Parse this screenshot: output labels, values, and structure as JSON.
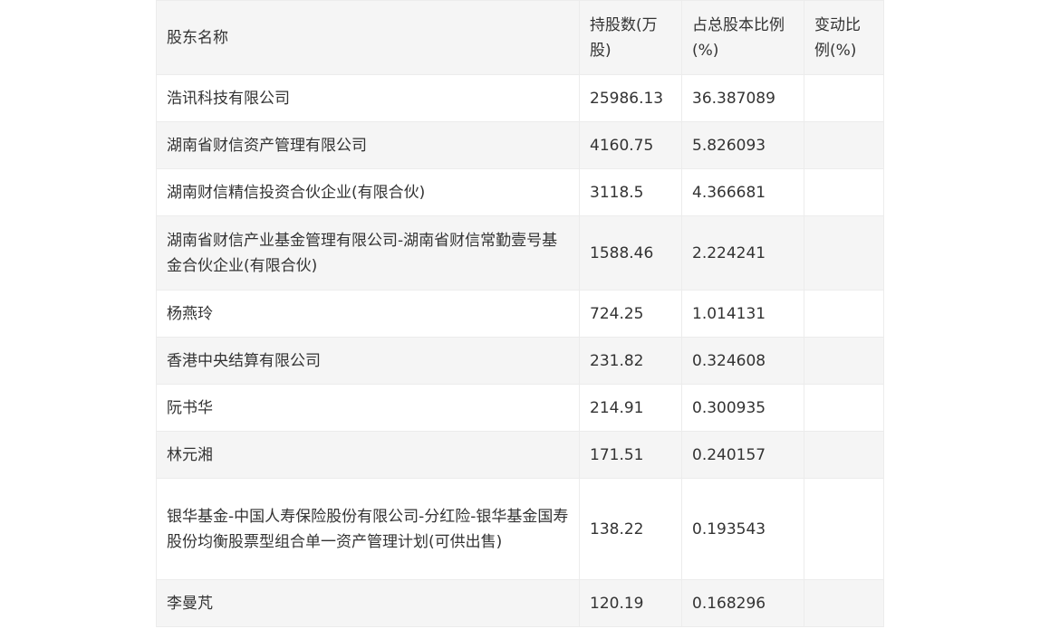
{
  "table": {
    "headers": [
      "股东名称",
      "持股数(万股)",
      "占总股本比例(%)",
      "变动比例(%)"
    ],
    "rows": [
      [
        "浩讯科技有限公司",
        "25986.13",
        "36.387089",
        ""
      ],
      [
        "湖南省财信资产管理有限公司",
        "4160.75",
        "5.826093",
        ""
      ],
      [
        "湖南财信精信投资合伙企业(有限合伙)",
        "3118.5",
        "4.366681",
        ""
      ],
      [
        "湖南省财信产业基金管理有限公司-湖南省财信常勤壹号基金合伙企业(有限合伙)",
        "1588.46",
        "2.224241",
        ""
      ],
      [
        "杨燕玲",
        "724.25",
        "1.014131",
        ""
      ],
      [
        "香港中央结算有限公司",
        "231.82",
        "0.324608",
        ""
      ],
      [
        "阮书华",
        "214.91",
        "0.300935",
        ""
      ],
      [
        "林元湘",
        "171.51",
        "0.240157",
        ""
      ],
      [
        "银华基金-中国人寿保险股份有限公司-分红险-银华基金国寿股份均衡股票型组合单一资产管理计划(可供出售)",
        "138.22",
        "0.193543",
        ""
      ],
      [
        "李曼芃",
        "120.19",
        "0.168296",
        ""
      ]
    ]
  }
}
